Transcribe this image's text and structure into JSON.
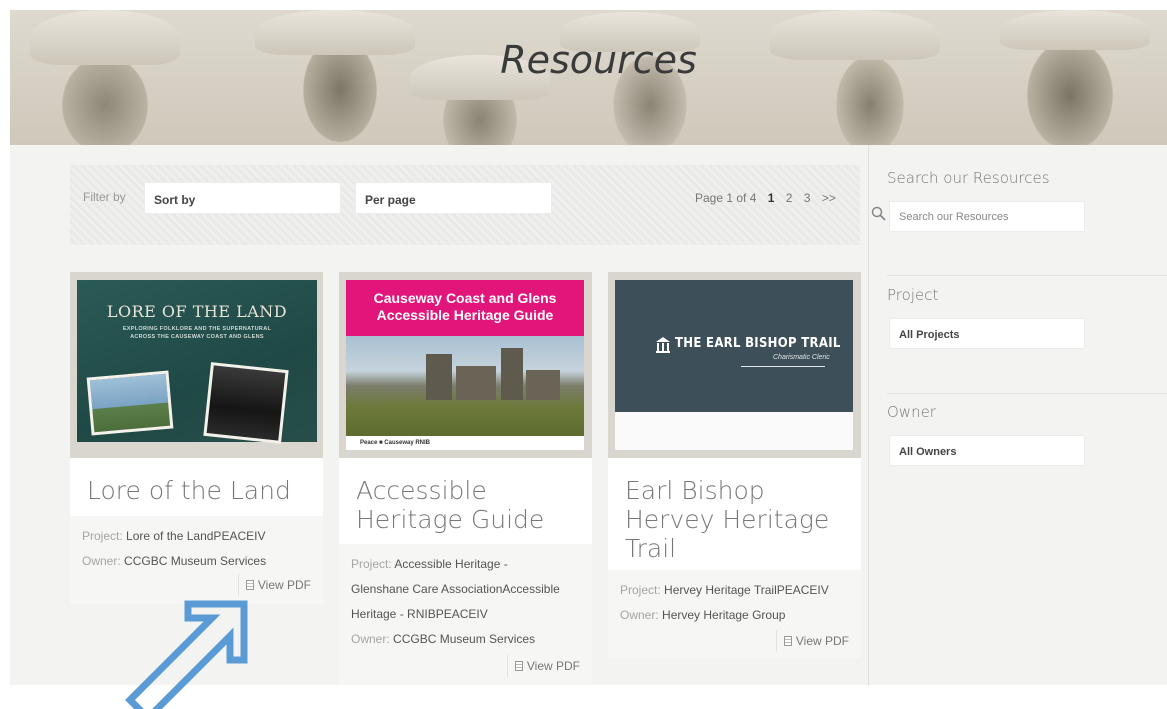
{
  "banner": {
    "title": "Resources"
  },
  "filters": {
    "filter_label": "Filter by",
    "sort_label": "Sort by",
    "per_page_label": "Per page"
  },
  "pagination": {
    "summary": "Page 1 of 4",
    "pages": [
      "1",
      "2",
      "3"
    ],
    "next": ">>",
    "current": "1"
  },
  "cards": [
    {
      "title": "Lore of the Land",
      "thumb": {
        "title": "LORE OF THE LAND",
        "subtitle_line1": "EXPLORING FOLKLORE AND THE SUPERNATURAL",
        "subtitle_line2": "ACROSS THE CAUSEWAY COAST AND GLENS"
      },
      "project_label": "Project:",
      "project_value": "Lore of the LandPEACEIV",
      "owner_label": "Owner:",
      "owner_value": "CCGBC Museum Services",
      "view_pdf": "View PDF"
    },
    {
      "title_line1": "Accessible",
      "title_line2": "Heritage Guide",
      "thumb": {
        "heading_line1": "Causeway Coast and Glens",
        "heading_line2": "Accessible Heritage Guide",
        "footer": "Peace  ■  Causeway   RNIB"
      },
      "project_label": "Project:",
      "project_value_line1": "Accessible Heritage -",
      "project_value_line2": "Glenshane Care AssociationAccessible",
      "project_value_line3": "Heritage - RNIBPEACEIV",
      "owner_label": "Owner:",
      "owner_value": "CCGBC Museum Services",
      "view_pdf": "View PDF"
    },
    {
      "title_line1": "Earl Bishop",
      "title_line2": "Hervey Heritage",
      "title_line3": "Trail",
      "thumb": {
        "title": "THE EARL BISHOP TRAIL",
        "subtitle": "Charismatic Cleric"
      },
      "project_label": "Project:",
      "project_value": "Hervey Heritage TrailPEACEIV",
      "owner_label": "Owner:",
      "owner_value": "Hervey Heritage Group",
      "view_pdf": "View PDF"
    }
  ],
  "sidebar": {
    "search_heading": "Search our Resources",
    "search_placeholder": "Search our Resources",
    "project_heading": "Project",
    "project_value": "All Projects",
    "owner_heading": "Owner",
    "owner_value": "All Owners"
  },
  "colors": {
    "accent_pink": "#e2167a",
    "earl_slate": "#3d4f58",
    "lore_teal": "#1f4946",
    "arrow_blue": "#5b9bd5"
  },
  "icons": [
    "search-icon",
    "document-icon",
    "arrow-annotation-icon",
    "temple-icon"
  ]
}
